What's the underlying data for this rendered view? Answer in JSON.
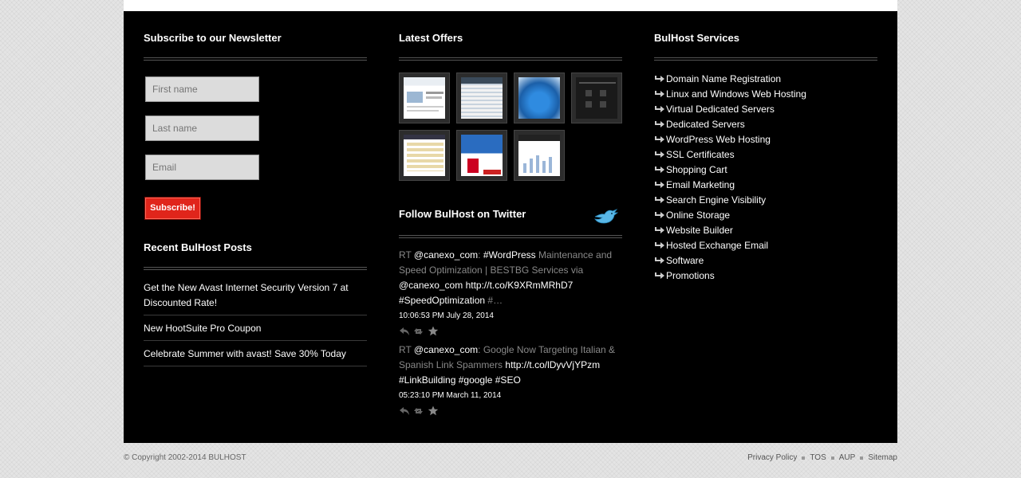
{
  "newsletter": {
    "title": "Subscribe to our Newsletter",
    "first_name_placeholder": "First name",
    "last_name_placeholder": "Last name",
    "email_placeholder": "Email",
    "subscribe_label": "Subscribe!"
  },
  "posts": {
    "title": "Recent BulHost Posts",
    "items": [
      "Get the New Avast Internet Security Version 7 at Discounted Rate!",
      "New HootSuite Pro Coupon",
      "Celebrate Summer with avast! Save 30% Today"
    ]
  },
  "offers": {
    "title": "Latest Offers",
    "thumbs": [
      "offer-thumbnail-1",
      "offer-thumbnail-2",
      "offer-thumbnail-3",
      "offer-thumbnail-4",
      "offer-thumbnail-5",
      "offer-thumbnail-6",
      "offer-thumbnail-7"
    ]
  },
  "twitter": {
    "title": "Follow BulHost on Twitter",
    "tweets": [
      {
        "rt": "RT",
        "user": "@canexo_com",
        "colon": ":",
        "tag1": "#WordPress",
        "text1": "Maintenance and Speed Optimization | BESTBG Services via",
        "mention": "@canexo_com",
        "link": "http://t.co/K9XRmMRhD7",
        "tag2": "#SpeedOptimization",
        "tail": "#…",
        "time": "10:06:53 PM July 28, 2014"
      },
      {
        "rt": "RT",
        "user": "@canexo_com",
        "colon": ":",
        "text1": "Google Now Targeting Italian & Spanish Link Spammers",
        "link": "http://t.co/lDyvVjYPzm",
        "tags": "#LinkBuilding #google #SEO",
        "time": "05:23:10 PM March 11, 2014"
      }
    ]
  },
  "services": {
    "title": "BulHost Services",
    "items": [
      "Domain Name Registration",
      "Linux and Windows Web Hosting",
      "Virtual Dedicated Servers",
      "Dedicated Servers",
      "WordPress Web Hosting",
      "SSL Certificates",
      "Shopping Cart",
      "Email Marketing",
      "Search Engine Visibility",
      "Online Storage",
      "Website Builder",
      "Hosted Exchange Email",
      "Software",
      "Promotions"
    ]
  },
  "bottom": {
    "copyright": "© Copyright 2002-2014 BULHOST",
    "links": [
      "Privacy Policy",
      "TOS",
      "AUP",
      "Sitemap"
    ]
  },
  "colors": {
    "panel": "#000000",
    "accent": "#e0251b",
    "field": "#dcdcdc",
    "muted_text": "#888888"
  }
}
